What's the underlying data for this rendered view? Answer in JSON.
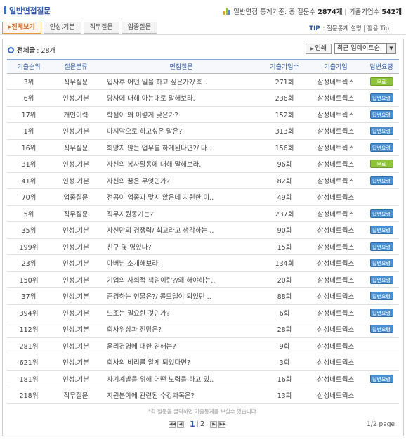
{
  "header": {
    "title": "일반면접질문",
    "stats_prefix": "일반면접 통계기준: 총 질문수",
    "question_count": "2874개",
    "stats_sep": "| 기출기업수",
    "company_count": "542개"
  },
  "tabs": [
    {
      "label": "▸전체보기",
      "active": true
    },
    {
      "label": "인성.기본",
      "active": false
    },
    {
      "label": "직무질문",
      "active": false
    },
    {
      "label": "업종질문",
      "active": false
    }
  ],
  "tip": {
    "label": "TIP",
    "text": ": 질문통계 설명 | 활용 Tip"
  },
  "toolbar": {
    "total_label": "전체글",
    "total_count": ": 28개",
    "print_label": "인쇄",
    "sort_value": "최근 업데이트순"
  },
  "table": {
    "headers": [
      "기출순위",
      "질문분류",
      "면접질문",
      "기출기업수",
      "기출기업",
      "답변요령"
    ],
    "rows": [
      {
        "rank": "3위",
        "category": "직무질문",
        "question": "입사후 어떤 일을 하고 싶은가?/ 회..",
        "count": "271회",
        "company": "삼성네트웍스",
        "badge": "무료"
      },
      {
        "rank": "6위",
        "category": "인성.기본",
        "question": "당사에 대해 아는대로 말해보라.",
        "count": "236회",
        "company": "삼성네트웍스",
        "badge": "답변요령"
      },
      {
        "rank": "17위",
        "category": "개인이력",
        "question": "학점이 왜 이렇게 낮은가?",
        "count": "152회",
        "company": "삼성네트웍스",
        "badge": "답변요령"
      },
      {
        "rank": "1위",
        "category": "인성.기본",
        "question": "마지막으로 하고싶은 말은?",
        "count": "313회",
        "company": "삼성네트웍스",
        "badge": "답변요령"
      },
      {
        "rank": "16위",
        "category": "직무질문",
        "question": "희망치 않는 업무를 하게된다면?/ 다..",
        "count": "156회",
        "company": "삼성네트웍스",
        "badge": "답변요령"
      },
      {
        "rank": "31위",
        "category": "인성.기본",
        "question": "자신의 봉사활동에 대해 말해보라.",
        "count": "96회",
        "company": "삼성네트웍스",
        "badge": "무료"
      },
      {
        "rank": "41위",
        "category": "인성.기본",
        "question": "자신의 꿈은 무엇인가?",
        "count": "82회",
        "company": "삼성네트웍스",
        "badge": "답변요령"
      },
      {
        "rank": "70위",
        "category": "업종질문",
        "question": "전공이 업종과 맞지 않은데 지원한 이..",
        "count": "49회",
        "company": "삼성네트웍스",
        "badge": ""
      },
      {
        "rank": "5위",
        "category": "직무질문",
        "question": "직무지원동기는?",
        "count": "237회",
        "company": "삼성네트웍스",
        "badge": "답변요령"
      },
      {
        "rank": "35위",
        "category": "인성.기본",
        "question": "자신만의 경쟁력/ 최고라고 생각하는 ..",
        "count": "90회",
        "company": "삼성네트웍스",
        "badge": "답변요령"
      },
      {
        "rank": "199위",
        "category": "인성.기본",
        "question": "친구 몇 명있나?",
        "count": "15회",
        "company": "삼성네트웍스",
        "badge": "답변요령"
      },
      {
        "rank": "23위",
        "category": "인성.기본",
        "question": "아버님 소개해보라.",
        "count": "134회",
        "company": "삼성네트웍스",
        "badge": "답변요령"
      },
      {
        "rank": "150위",
        "category": "인성.기본",
        "question": "기업의 사회적 책임이란?/왜 해야하는..",
        "count": "20회",
        "company": "삼성네트웍스",
        "badge": "답변요령"
      },
      {
        "rank": "37위",
        "category": "인성.기본",
        "question": "존경하는 인물은?/ 롤모델이 되었던 ..",
        "count": "88회",
        "company": "삼성네트웍스",
        "badge": "답변요령"
      },
      {
        "rank": "394위",
        "category": "인성.기본",
        "question": "노조는 필요한 것인가?",
        "count": "6회",
        "company": "삼성네트웍스",
        "badge": "답변요령"
      },
      {
        "rank": "112위",
        "category": "인성.기본",
        "question": "회사위상과 전망은?",
        "count": "28회",
        "company": "삼성네트웍스",
        "badge": "답변요령"
      },
      {
        "rank": "281위",
        "category": "인성.기본",
        "question": "윤리경영에 대한 견해는?",
        "count": "9회",
        "company": "삼성네트웍스",
        "badge": ""
      },
      {
        "rank": "621위",
        "category": "인성.기본",
        "question": "회사의 비리를 알게 되었다면?",
        "count": "3회",
        "company": "삼성네트웍스",
        "badge": ""
      },
      {
        "rank": "181위",
        "category": "인성.기본",
        "question": "자기계발을 위해 어떤 노력을 하고 있..",
        "count": "16회",
        "company": "삼성네트웍스",
        "badge": "답변요령"
      },
      {
        "rank": "218위",
        "category": "직무질문",
        "question": "지원분야에 관련된 수강과목은?",
        "count": "13회",
        "company": "삼성네트웍스",
        "badge": ""
      }
    ]
  },
  "footer": {
    "note": "*각 질문을 클릭하면 기출통계를 보실수 있습니다.",
    "current_page": "1",
    "separator": "|",
    "next_page": "2",
    "page_info": "1/2 page"
  },
  "colors": {
    "accent": "#2d57a5",
    "tab_active": "#d0661e",
    "badge_free": "#8fc43a",
    "badge_answer": "#4a8fd1"
  }
}
